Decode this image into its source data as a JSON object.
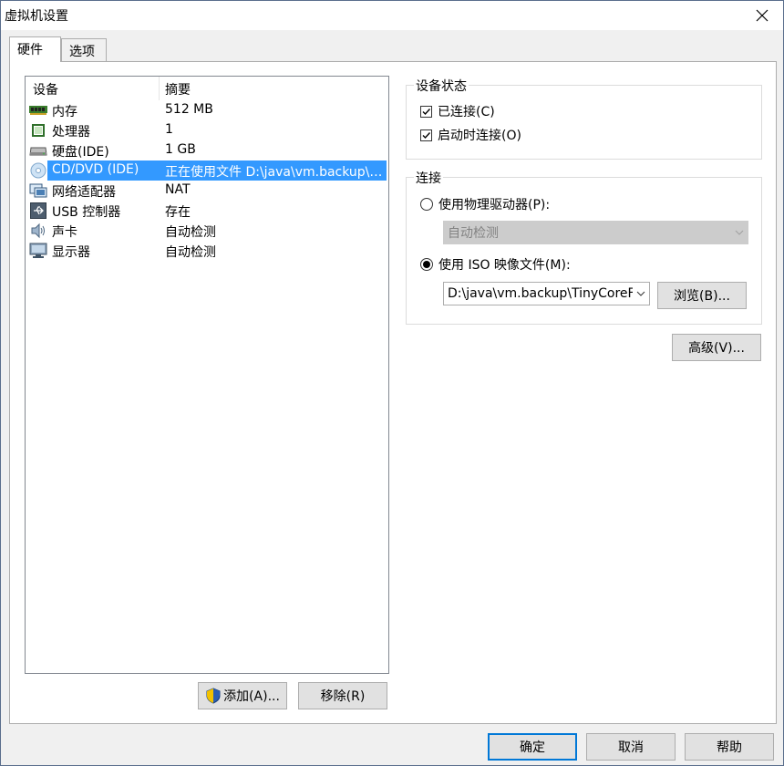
{
  "window": {
    "title": "虚拟机设置"
  },
  "tabs": [
    {
      "label": "硬件",
      "active": true
    },
    {
      "label": "选项",
      "active": false
    }
  ],
  "device_list": {
    "headers": {
      "device": "设备",
      "summary": "摘要"
    },
    "rows": [
      {
        "name": "内存",
        "summary": "512 MB",
        "icon": "memory-icon",
        "selected": false
      },
      {
        "name": "处理器",
        "summary": "1",
        "icon": "processor-icon",
        "selected": false
      },
      {
        "name": "硬盘(IDE)",
        "summary": "1 GB",
        "icon": "hard-disk-icon",
        "selected": false
      },
      {
        "name": "CD/DVD (IDE)",
        "summary": "正在使用文件 D:\\java\\vm.backup\\TinyCore",
        "icon": "cd-dvd-icon",
        "selected": true
      },
      {
        "name": "网络适配器",
        "summary": "NAT",
        "icon": "network-adapter-icon",
        "selected": false
      },
      {
        "name": "USB 控制器",
        "summary": "存在",
        "icon": "usb-icon",
        "selected": false
      },
      {
        "name": "声卡",
        "summary": "自动检测",
        "icon": "sound-card-icon",
        "selected": false
      },
      {
        "name": "显示器",
        "summary": "自动检测",
        "icon": "display-icon",
        "selected": false
      }
    ],
    "add_label": "添加(A)...",
    "remove_label": "移除(R)"
  },
  "device_status": {
    "title": "设备状态",
    "connected": {
      "label": "已连接(C)",
      "checked": true
    },
    "connect_on_start": {
      "label": "启动时连接(O)",
      "checked": true
    }
  },
  "connection": {
    "title": "连接",
    "physical": {
      "label": "使用物理驱动器(P):",
      "selected": false,
      "drive_value": "自动检测"
    },
    "iso": {
      "label": "使用 ISO 映像文件(M):",
      "selected": true,
      "path_value": "D:\\java\\vm.backup\\TinyCoreF"
    },
    "browse_label": "浏览(B)..."
  },
  "advanced_label": "高级(V)...",
  "footer": {
    "ok_label": "确定",
    "cancel_label": "取消",
    "help_label": "帮助"
  },
  "colors": {
    "selection": "#3399ff",
    "primary_border": "#0078d7"
  }
}
